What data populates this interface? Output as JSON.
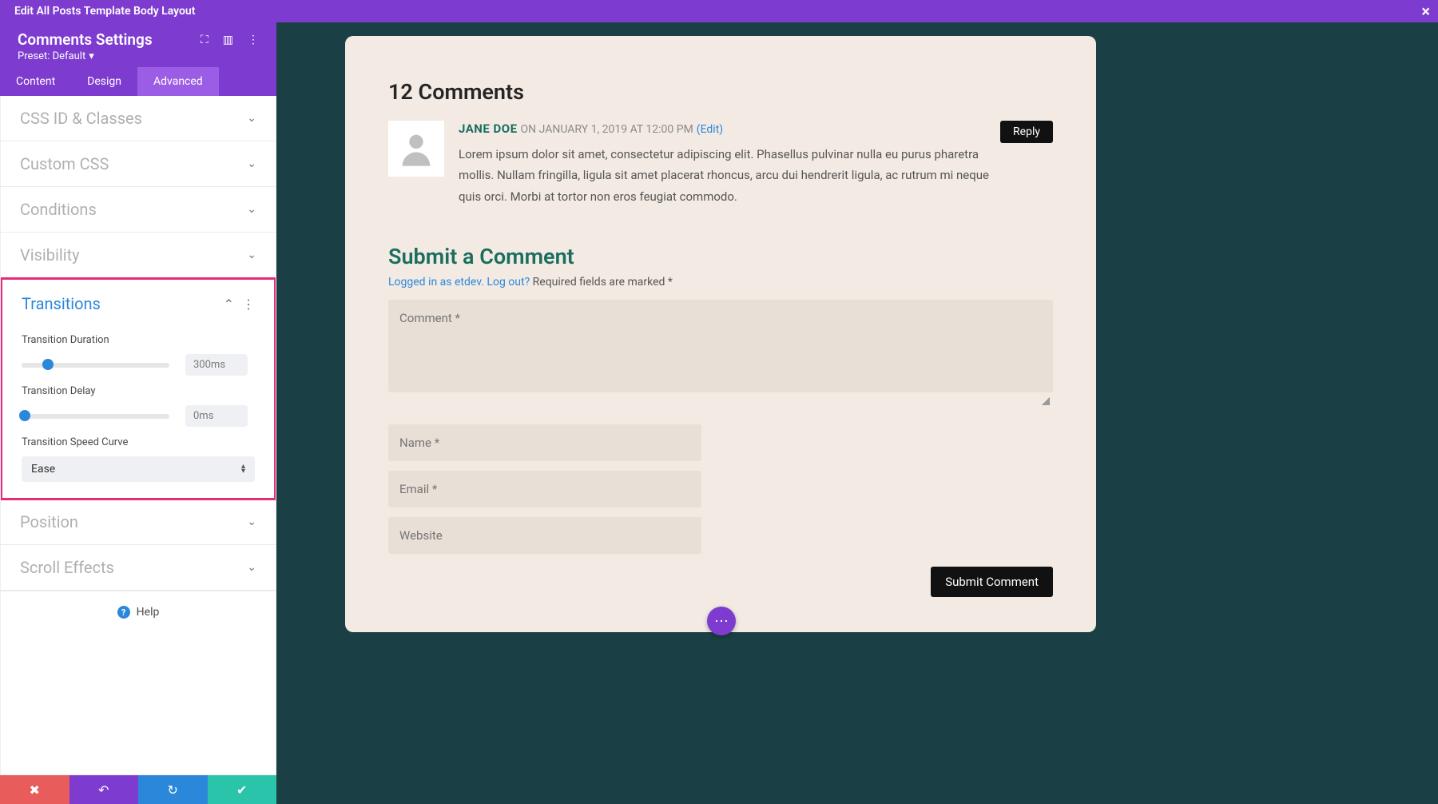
{
  "topbar": {
    "title": "Edit All Posts Template Body Layout"
  },
  "panel": {
    "title": "Comments Settings",
    "preset": "Preset: Default",
    "tabs": {
      "content": "Content",
      "design": "Design",
      "advanced": "Advanced"
    },
    "sections": {
      "css_id": "CSS ID & Classes",
      "custom_css": "Custom CSS",
      "conditions": "Conditions",
      "visibility": "Visibility",
      "transitions": "Transitions",
      "position": "Position",
      "scroll": "Scroll Effects"
    },
    "transitions": {
      "duration_label": "Transition Duration",
      "duration_value": "300ms",
      "delay_label": "Transition Delay",
      "delay_value": "0ms",
      "curve_label": "Transition Speed Curve",
      "curve_value": "Ease"
    },
    "help": "Help"
  },
  "preview": {
    "comments_title": "12 Comments",
    "comment": {
      "author": "JANE DOE",
      "date": "ON JANUARY 1, 2019 AT 12:00 PM",
      "edit": "(Edit)",
      "text": "Lorem ipsum dolor sit amet, consectetur adipiscing elit. Phasellus pulvinar nulla eu purus pharetra mollis. Nullam fringilla, ligula sit amet placerat rhoncus, arcu dui hendrerit ligula, ac rutrum mi neque quis orci. Morbi at tortor non eros feugiat commodo.",
      "reply": "Reply"
    },
    "submit_title": "Submit a Comment",
    "logged_in": "Logged in as etdev.",
    "logout": "Log out?",
    "required": "Required fields are marked *",
    "ph_comment": "Comment *",
    "ph_name": "Name *",
    "ph_email": "Email *",
    "ph_website": "Website",
    "submit_btn": "Submit Comment"
  }
}
